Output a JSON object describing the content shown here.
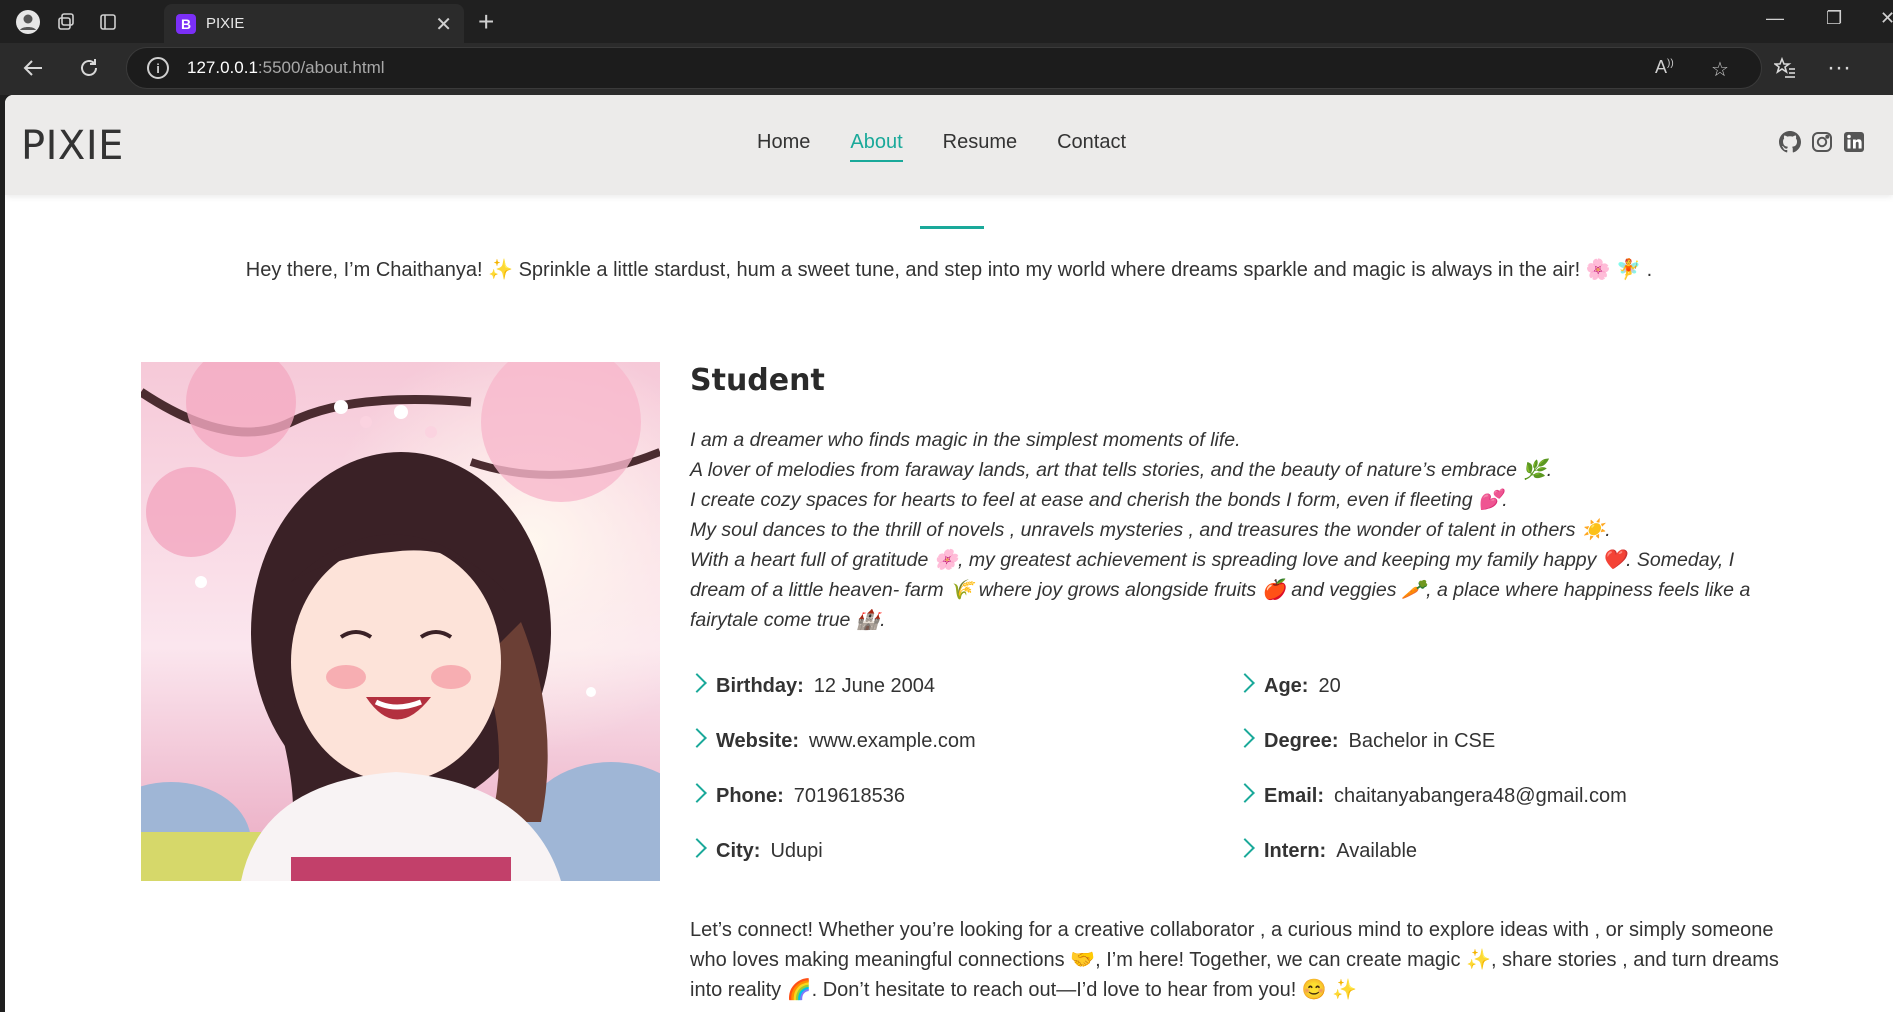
{
  "browser": {
    "tab_title": "PIXIE",
    "tab_favicon_letter": "B",
    "url_host": "127.0.0.1",
    "url_rest": ":5500/about.html"
  },
  "site": {
    "logo": "PIXIE",
    "nav": [
      "Home",
      "About",
      "Resume",
      "Contact"
    ],
    "active_nav": "About",
    "accent_color": "#1aa99a"
  },
  "about": {
    "intro": "Hey there, I’m Chaithanya! ✨ Sprinkle a little stardust, hum a sweet tune, and step into my world where dreams sparkle and magic is always in the air! 🌸 🧚 .",
    "role": "Student",
    "bio_lines": [
      "I am a dreamer who finds magic in the simplest moments of life.",
      "A lover of melodies from faraway lands, art that tells stories, and the beauty of nature’s embrace 🌿.",
      "I create cozy spaces for hearts to feel at ease and cherish the bonds I form, even if fleeting 💕.",
      "My soul dances to the thrill of novels , unravels mysteries , and treasures the wonder of talent in others ☀️.",
      "With a heart full of gratitude 🌸, my greatest achievement is spreading love and keeping my family happy ❤️. Someday, I dream of a little heaven- farm 🌾 where joy grows alongside fruits 🍎 and veggies 🥕, a place where happiness feels like a fairytale come true 🏰."
    ],
    "details": [
      {
        "label": "Birthday:",
        "value": "12 June 2004"
      },
      {
        "label": "Age:",
        "value": "20"
      },
      {
        "label": "Website:",
        "value": "www.example.com"
      },
      {
        "label": "Degree:",
        "value": "Bachelor in CSE"
      },
      {
        "label": "Phone:",
        "value": "7019618536"
      },
      {
        "label": "Email:",
        "value": "chaitanyabangera48@gmail.com"
      },
      {
        "label": "City:",
        "value": "Udupi"
      },
      {
        "label": "Intern:",
        "value": "Available"
      }
    ],
    "outro": "Let’s connect! Whether you’re looking for a creative collaborator , a curious mind to explore ideas with , or simply someone who loves making meaningful connections 🤝, I’m here! Together, we can create magic ✨, share stories , and turn dreams into reality 🌈. Don’t hesitate to reach out—I’d love to hear from you! 😊 ✨"
  }
}
